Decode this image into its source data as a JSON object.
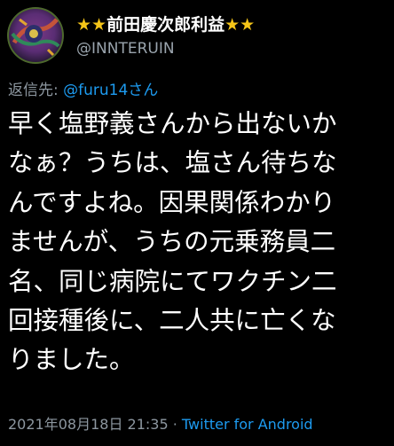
{
  "author": {
    "star_left": "★★",
    "display_name": "前田慶次郎利益",
    "star_right": "★★",
    "handle": "@INNTERUIN"
  },
  "reply": {
    "prefix": "返信先: ",
    "mention": "@furu14さん"
  },
  "tweet": {
    "lines": [
      "早く塩野義さんから出ないか",
      "なぁ？うちは、塩さん待ちな",
      "んですよね。因果関係わかり",
      "ませんが、うちの元乗務員二",
      "名、同じ病院にてワクチン二",
      "回接種後に、二人共に亡くな",
      "りました。"
    ]
  },
  "footer": {
    "timestamp": "2021年08月18日 21:35",
    "separator": " · ",
    "source": "Twitter for Android"
  },
  "colors": {
    "background": "#000000",
    "text": "#ffffff",
    "secondary": "#8d97a0",
    "link": "#1d9bf0",
    "star": "#f5c518"
  }
}
